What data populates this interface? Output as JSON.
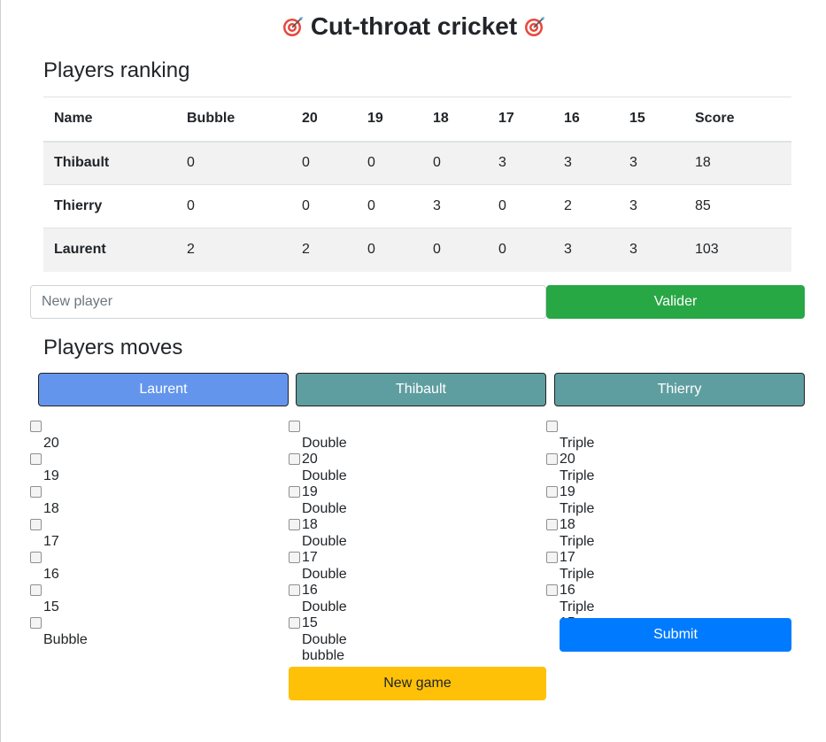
{
  "title": "Cut-throat cricket",
  "ranking": {
    "heading": "Players ranking",
    "columns": [
      "Name",
      "Bubble",
      "20",
      "19",
      "18",
      "17",
      "16",
      "15",
      "Score"
    ],
    "rows": [
      [
        "Thibault",
        "0",
        "0",
        "0",
        "0",
        "3",
        "3",
        "3",
        "18"
      ],
      [
        "Thierry",
        "0",
        "0",
        "0",
        "3",
        "0",
        "2",
        "3",
        "85"
      ],
      [
        "Laurent",
        "2",
        "2",
        "0",
        "0",
        "0",
        "3",
        "3",
        "103"
      ]
    ]
  },
  "new_player": {
    "placeholder": "New player",
    "value": "",
    "button": "Valider"
  },
  "moves": {
    "heading": "Players moves",
    "players": [
      "Laurent",
      "Thibault",
      "Thierry"
    ],
    "active_player": "Laurent",
    "single": [
      "20",
      "19",
      "18",
      "17",
      "16",
      "15",
      "Bubble"
    ],
    "double": [
      "Double 20",
      "Double 19",
      "Double 18",
      "Double 17",
      "Double 16",
      "Double 15",
      "Double bubble"
    ],
    "triple": [
      "Triple 20",
      "Triple 19",
      "Triple 18",
      "Triple 17",
      "Triple 16",
      "Triple 15"
    ],
    "submit": "Submit"
  },
  "new_game": "New game",
  "colors": {
    "valider": "#28a745",
    "active_player": "#6495ed",
    "inactive_player": "#5f9ea0",
    "submit": "#007bff",
    "new_game": "#ffc107",
    "row_stripe": "#f2f2f2"
  },
  "icons": {
    "title": "direct-hit-target-icon"
  }
}
